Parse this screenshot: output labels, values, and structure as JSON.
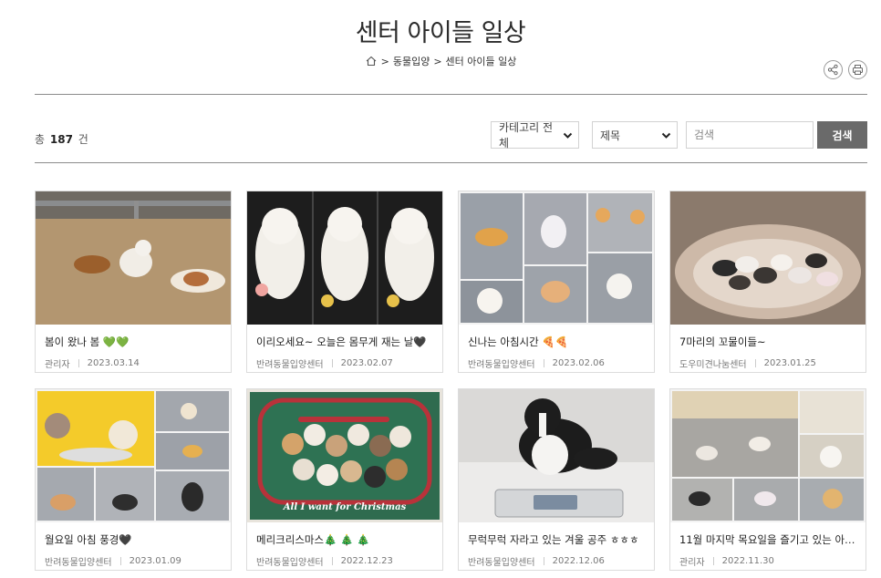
{
  "page": {
    "title": "센터 아이들 일상",
    "breadcrumb": [
      "동물입양",
      "센터 아이들 일상"
    ],
    "breadcrumb_sep": ">"
  },
  "board": {
    "count_prefix": "총",
    "count": "187",
    "count_suffix": "건",
    "category_select": "카테고리 전체",
    "field_select": "제목",
    "search_placeholder": "검색",
    "search_button": "검색"
  },
  "posts": [
    {
      "title": "봄이 왔나 봄 💚💚",
      "author": "관리자",
      "date": "2023.03.14"
    },
    {
      "title": "이리오세요~ 오늘은 몸무게 재는 날🖤",
      "author": "반려동물입양센터",
      "date": "2023.02.07"
    },
    {
      "title": "신나는 아침시간 🍕🍕",
      "author": "반려동물입양센터",
      "date": "2023.02.06"
    },
    {
      "title": "7마리의 꼬물이들~",
      "author": "도우미견나눔센터",
      "date": "2023.01.25"
    },
    {
      "title": "월요일 아침 풍경🖤",
      "author": "반려동물입양센터",
      "date": "2023.01.09"
    },
    {
      "title": "메리크리스마스🎄 🎄 🎄",
      "author": "반려동물입양센터",
      "date": "2022.12.23"
    },
    {
      "title": "무럭무럭 자라고 있는 겨울 공주 ㅎㅎㅎ",
      "author": "반려동물입양센터",
      "date": "2022.12.06"
    },
    {
      "title": "11월 마지막 목요일을 즐기고 있는 아…",
      "author": "관리자",
      "date": "2022.11.30"
    }
  ],
  "thumb_texts": {
    "christmas": "All I want for Christmas"
  },
  "colors": {
    "search_button_bg": "#6a6a6a",
    "divider": "#8c8c8c",
    "christmas_green": "#2f6b4f",
    "christmas_red": "#b8323a"
  }
}
